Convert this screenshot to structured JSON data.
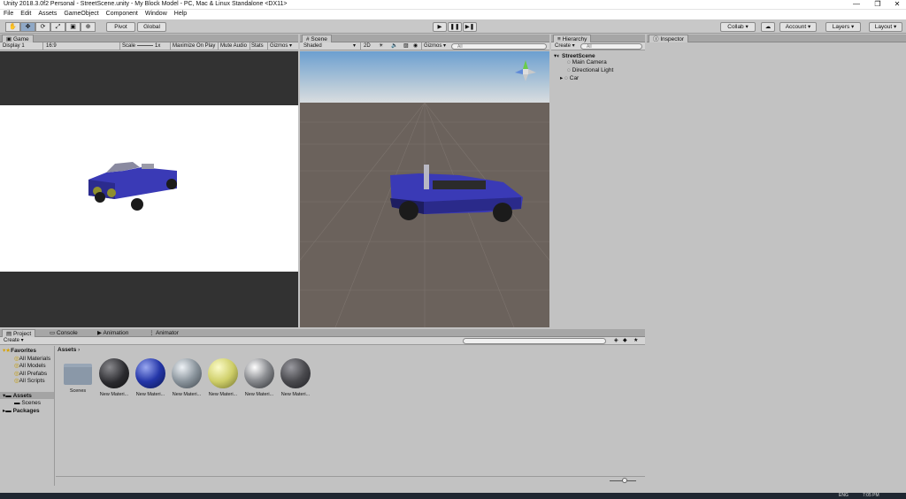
{
  "window": {
    "title": "Unity 2018.3.0f2 Personal - StreetScene.unity - My Block Model - PC, Mac & Linux Standalone <DX11>",
    "min": "—",
    "restore": "❐",
    "close": "✕"
  },
  "menu": [
    "File",
    "Edit",
    "Assets",
    "GameObject",
    "Component",
    "Window",
    "Help"
  ],
  "toolbar": {
    "pivot": "Pivot",
    "global": "Global",
    "collab": "Collab ▾",
    "account": "Account ▾",
    "layers": "Layers ▾",
    "layout": "Layout ▾"
  },
  "game": {
    "tab": "Game",
    "display": "Display 1",
    "aspect": "16:9",
    "scale_label": "Scale",
    "scale_value": "1x",
    "maximize": "Maximize On Play",
    "mute": "Mute Audio",
    "stats": "Stats",
    "gizmos": "Gizmos ▾"
  },
  "scene": {
    "tab": "Scene",
    "shading": "Shaded",
    "mode2d": "2D",
    "gizmos": "Gizmos ▾",
    "search_placeholder": "All"
  },
  "hierarchy": {
    "tab": "Hierarchy",
    "create": "Create ▾",
    "search_placeholder": "All",
    "scene_name": "StreetScene",
    "items": [
      "Main Camera",
      "Directional Light",
      "Car"
    ]
  },
  "inspector": {
    "tab": "Inspector"
  },
  "bottom_tabs": [
    "Project",
    "Console",
    "Animation",
    "Animator"
  ],
  "project": {
    "create": "Create ▾",
    "favorites_label": "Favorites",
    "favorites": [
      "All Materials",
      "All Models",
      "All Prefabs",
      "All Scripts"
    ],
    "assets_label": "Assets",
    "assets_children": [
      "Scenes"
    ],
    "packages_label": "Packages",
    "breadcrumb": "Assets",
    "items": [
      {
        "name": "Scenes",
        "kind": "folder"
      },
      {
        "name": "New Materi...",
        "color": "#2a2a2e"
      },
      {
        "name": "New Materi...",
        "color": "#2436a8"
      },
      {
        "name": "New Materi...",
        "color": "#8a949c"
      },
      {
        "name": "New Materi...",
        "color": "#cfcf6a"
      },
      {
        "name": "New Materi...",
        "color": "#8e9094"
      },
      {
        "name": "New Materi...",
        "color": "#4a4a4e"
      }
    ]
  },
  "taskbar": {
    "lang": "ENG",
    "time": "7:05 PM"
  },
  "colors": {
    "car_body": "#3a3ab6",
    "scene_bg": "#6b625c",
    "sky": "#a8c4dc"
  }
}
